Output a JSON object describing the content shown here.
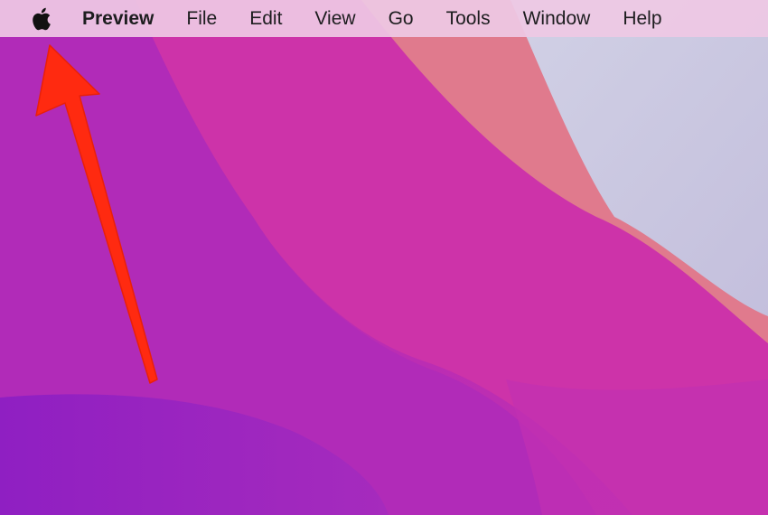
{
  "menubar": {
    "apple_icon": "apple-logo-icon",
    "app_name": "Preview",
    "items": [
      "File",
      "Edit",
      "View",
      "Go",
      "Tools",
      "Window",
      "Help"
    ]
  },
  "annotation": {
    "icon": "red-arrow-icon",
    "color": "#ff2a10"
  },
  "wallpaper": {
    "colors": [
      "#a428bd",
      "#cc33a8",
      "#e0788a",
      "#c9c4de"
    ]
  }
}
